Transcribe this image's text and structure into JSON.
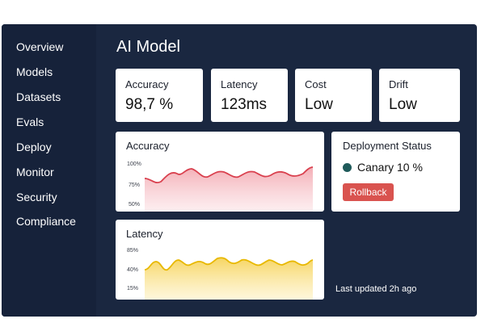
{
  "sidebar": {
    "items": [
      {
        "label": "Overview"
      },
      {
        "label": "Models"
      },
      {
        "label": "Datasets"
      },
      {
        "label": "Evals"
      },
      {
        "label": "Deploy"
      },
      {
        "label": "Monitor"
      },
      {
        "label": "Security"
      },
      {
        "label": "Compliance"
      }
    ]
  },
  "header": {
    "title": "AI Model"
  },
  "stats": [
    {
      "label": "Accuracy",
      "value": "98,7 %"
    },
    {
      "label": "Latency",
      "value": "123ms"
    },
    {
      "label": "Cost",
      "value": "Low"
    },
    {
      "label": "Drift",
      "value": "Low"
    }
  ],
  "charts": {
    "accuracy": {
      "title": "Accuracy",
      "ticks": [
        "100%",
        "75%",
        "50%"
      ],
      "line_color": "#d9404e",
      "fill_color": "#f3aab2"
    },
    "latency": {
      "title": "Latency",
      "ticks": [
        "85%",
        "40%",
        "15%"
      ],
      "line_color": "#e8b800",
      "fill_color": "#f9e08a"
    }
  },
  "deployment": {
    "title": "Deployment Status",
    "status": "Canary 10 %",
    "status_color": "#1f5a5a",
    "action_label": "Rollback",
    "action_color": "#d9534f"
  },
  "footer": {
    "last_updated": "Last updated 2h ago"
  }
}
